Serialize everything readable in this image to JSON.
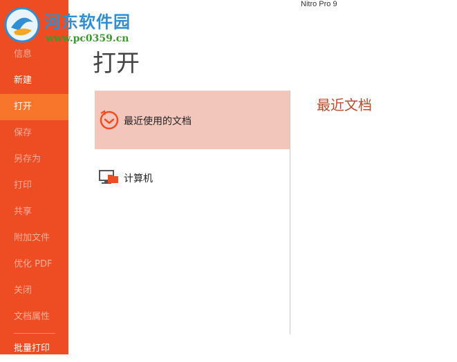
{
  "app": {
    "title": "Nitro Pro 9"
  },
  "watermark": {
    "site_name": "河东软件园",
    "url": "www.pc0359.cn"
  },
  "sidebar": {
    "items": [
      {
        "label": "信息"
      },
      {
        "label": "新建"
      },
      {
        "label": "打开"
      },
      {
        "label": "保存"
      },
      {
        "label": "另存为"
      },
      {
        "label": "打印"
      },
      {
        "label": "共享"
      },
      {
        "label": "附加文件"
      },
      {
        "label": "优化 PDF"
      },
      {
        "label": "关闭"
      },
      {
        "label": "文档属性"
      },
      {
        "label": "批量打印"
      }
    ],
    "active_index": 2
  },
  "page": {
    "title": "打开"
  },
  "sources": [
    {
      "label": "最近使用的文档",
      "icon": "recent-clock-icon"
    },
    {
      "label": "计算机",
      "icon": "computer-folder-icon"
    }
  ],
  "recent": {
    "title": "最近文档"
  },
  "colors": {
    "sidebar": "#ee4c22",
    "sidebar_active": "#f7762c",
    "selected_row": "#f2c6bb",
    "recent_title": "#b84a2a"
  }
}
